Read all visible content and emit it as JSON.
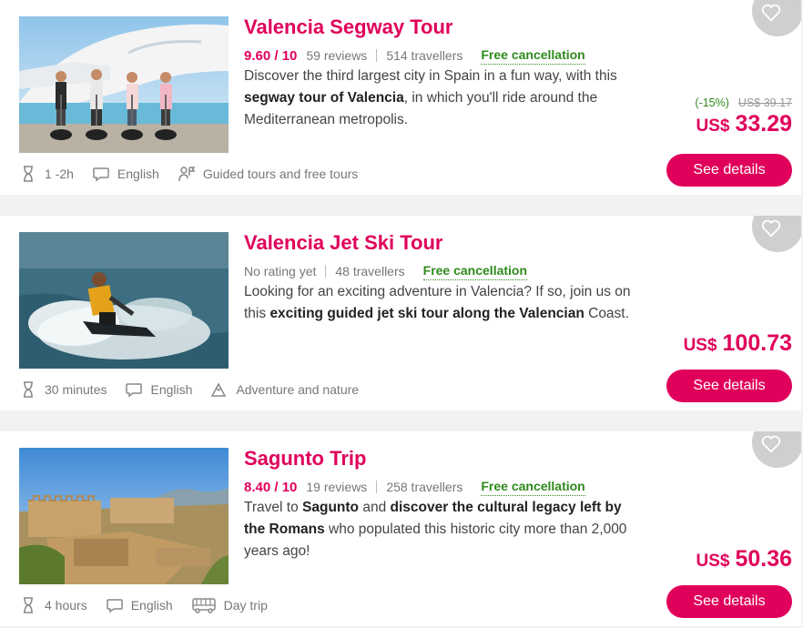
{
  "tours": [
    {
      "title": "Valencia Segway Tour",
      "score": "9.60 / 10",
      "reviews": "59 reviews",
      "travellers": "514 travellers",
      "free_cancellation": "Free cancellation",
      "desc": [
        {
          "t": "Discover the third largest city in Spain in a fun way, with this ",
          "b": false
        },
        {
          "t": "segway tour of Valencia",
          "b": true
        },
        {
          "t": ", in which you'll ride around the Mediterranean metropolis.",
          "b": false
        }
      ],
      "duration": "1 -2h",
      "language": "English",
      "category": "Guided tours and free tours",
      "category_icon": "guide-icon",
      "discount": "(-15%)",
      "old_price": "US$ 39.17",
      "currency": "US$",
      "price": "33.29",
      "details_label": "See details"
    },
    {
      "title": "Valencia Jet Ski Tour",
      "no_rating": "No rating yet",
      "travellers": "48 travellers",
      "free_cancellation": "Free cancellation",
      "desc": [
        {
          "t": "Looking for an exciting adventure in Valencia? If so, join us on this ",
          "b": false
        },
        {
          "t": "exciting guided jet ski tour along the Valencian",
          "b": true
        },
        {
          "t": " Coast.",
          "b": false
        }
      ],
      "duration": "30 minutes",
      "language": "English",
      "category": "Adventure and nature",
      "category_icon": "mountain-icon",
      "currency": "US$",
      "price": "100.73",
      "details_label": "See details"
    },
    {
      "title": "Sagunto Trip",
      "score": "8.40 / 10",
      "reviews": "19 reviews",
      "travellers": "258 travellers",
      "free_cancellation": "Free cancellation",
      "desc": [
        {
          "t": "Travel to ",
          "b": false
        },
        {
          "t": "Sagunto",
          "b": true
        },
        {
          "t": " and ",
          "b": false
        },
        {
          "t": "discover the cultural legacy left by the Romans",
          "b": true
        },
        {
          "t": " who populated this historic city more than 2,000 years ago!",
          "b": false
        }
      ],
      "duration": "4 hours",
      "language": "English",
      "category": "Day trip",
      "category_icon": "bus-icon",
      "currency": "US$",
      "price": "50.36",
      "details_label": "See details"
    }
  ],
  "colors": {
    "accent": "#e0005b",
    "free_cancellation": "#2f8a1d",
    "background": "#f2f2f2"
  }
}
